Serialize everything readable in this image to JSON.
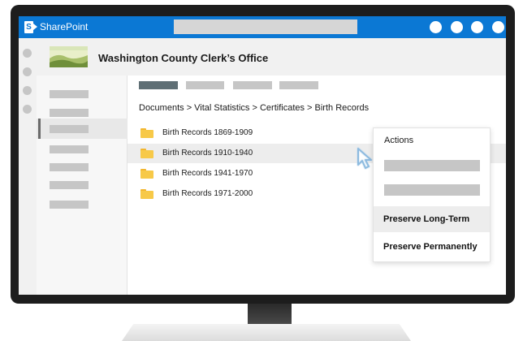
{
  "app": {
    "brand": "SharePoint",
    "logo_letter": "S",
    "accent_color": "#0b78d4"
  },
  "site": {
    "title": "Washington County Clerk’s Office"
  },
  "breadcrumb": "Documents > Vital Statistics > Certificates > Birth Records",
  "folders": [
    {
      "name": "Birth Records 1869-1909"
    },
    {
      "name": "Birth Records 1910-1940"
    },
    {
      "name": "Birth Records 1941-1970"
    },
    {
      "name": "Birth Records 1971-2000"
    }
  ],
  "actions_menu": {
    "title": "Actions",
    "items": [
      {
        "label": "Preserve Long-Term"
      },
      {
        "label": "Preserve Permanently"
      }
    ]
  },
  "icons": [
    "sharepoint-logo-icon",
    "folder-icon",
    "mouse-pointer-icon",
    "site-logo-landscape"
  ]
}
